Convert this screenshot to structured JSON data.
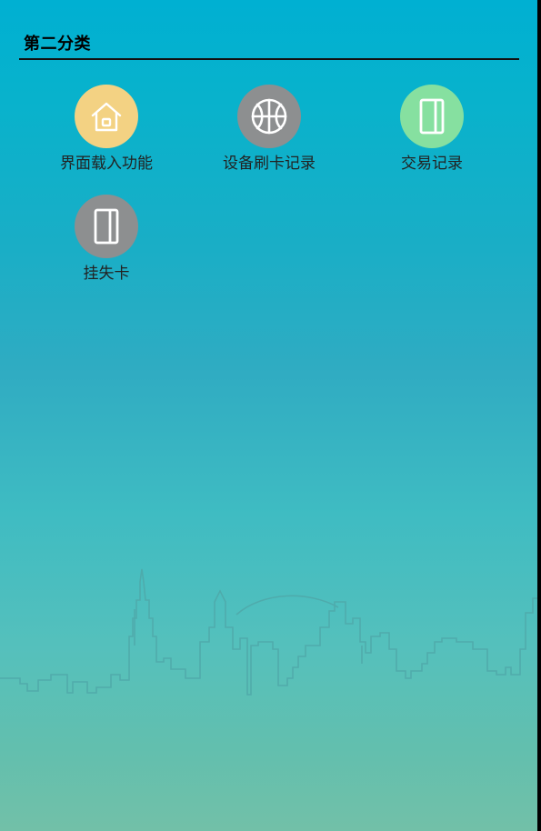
{
  "section": {
    "title": "第二分类"
  },
  "tiles": [
    {
      "label": "界面载入功能",
      "icon": "home-icon",
      "color": "#f3d283"
    },
    {
      "label": "设备刷卡记录",
      "icon": "basketball-icon",
      "color": "#8d8f90"
    },
    {
      "label": "交易记录",
      "icon": "card-icon",
      "color": "#86e0a0"
    },
    {
      "label": "挂失卡",
      "icon": "card-icon",
      "color": "#8d8f90"
    }
  ],
  "theme": {
    "background_top": "#00b0d2",
    "background_bottom": "#72c0a8",
    "skyline_stroke": "#4fa7a8"
  }
}
